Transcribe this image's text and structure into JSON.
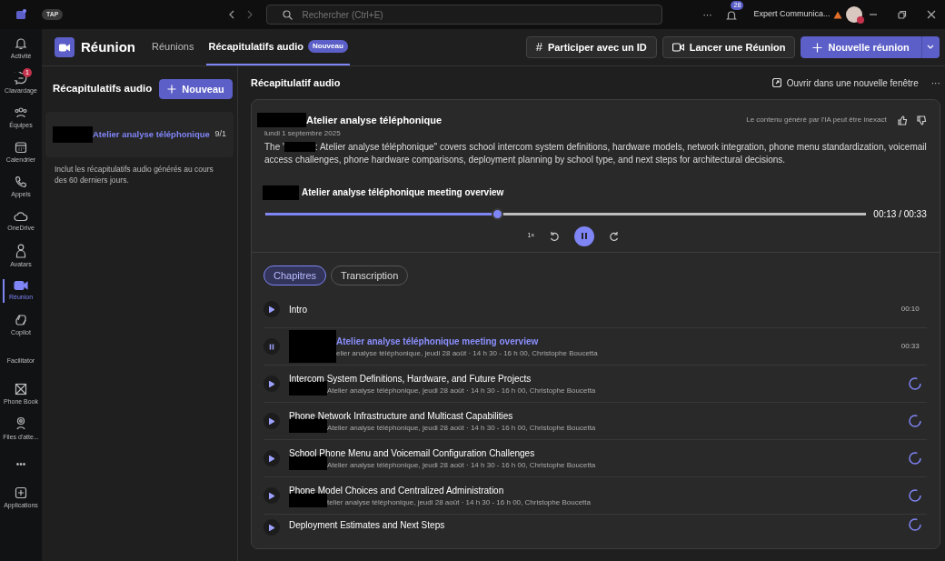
{
  "titlebar": {
    "org_badge": "TAP",
    "search": {
      "placeholder": "Rechercher (Ctrl+E)"
    },
    "more": "···",
    "notifications": "28",
    "user": "Expert Communica..."
  },
  "rail": [
    {
      "label": "Activité",
      "kind": "icon",
      "selected": false
    },
    {
      "label": "Clavardage",
      "kind": "icon",
      "badge": "1",
      "selected": false
    },
    {
      "label": "Équipes",
      "kind": "icon",
      "selected": false
    },
    {
      "label": "Calendrier",
      "kind": "icon",
      "selected": false
    },
    {
      "label": "Appels",
      "kind": "icon",
      "selected": false
    },
    {
      "label": "OneDrive",
      "kind": "icon",
      "selected": false
    },
    {
      "label": "Avatars",
      "kind": "icon",
      "selected": false
    },
    {
      "label": "Réunion",
      "kind": "icon",
      "selected": true
    },
    {
      "label": "Copilot",
      "kind": "icon",
      "selected": false
    },
    {
      "label": "Facilitator",
      "kind": "label",
      "selected": false
    },
    {
      "label": "Phone Book",
      "kind": "icon",
      "selected": false
    },
    {
      "label": "Files d'atte...",
      "kind": "icon",
      "selected": false
    },
    {
      "label": "•••",
      "kind": "more",
      "selected": false
    },
    {
      "label": "Applications",
      "kind": "icon",
      "selected": false
    }
  ],
  "header": {
    "title": "Réunion",
    "tabs": [
      {
        "label": "Réunions",
        "selected": false
      },
      {
        "label": "Récapitulatifs audio",
        "badge": "Nouveau",
        "selected": true
      }
    ],
    "buttons": [
      {
        "label": "Participer avec un ID",
        "kind": "hash",
        "symbol": "#"
      },
      {
        "label": "Lancer une Réunion",
        "kind": "camera"
      },
      {
        "label": "Nouvelle réunion",
        "kind": "primary"
      }
    ]
  },
  "left_panel": {
    "title": "Récapitulatifs audio",
    "new_button": "Nouveau",
    "items": [
      {
        "title": "Atelier analyse téléphonique",
        "date": "9/1",
        "selected": true
      }
    ],
    "note": "Inclut les récapitulatifs audio générés au cours des 60 derniers jours."
  },
  "main": {
    "title": "Récapitulatif audio",
    "open_window": "Ouvrir dans une nouvelle fenêtre",
    "more": "···",
    "recap": {
      "title": "Atelier analyse téléphonique",
      "ai_notice": "Le contenu généré par l'IA peut être inexact",
      "date": "lundi 1 septembre 2025",
      "description_start": "The '",
      "description_line_1": ": Atelier analyse téléphonique\" covers school intercom system definitions, hardware models, network integration, phone menu standardization, voicemail",
      "description_line_2": "access challenges, phone hardware comparisons, deployment planning by school type, and next steps for architectural decisions."
    },
    "player": {
      "title": "Atelier analyse téléphonique meeting overview",
      "level": 0.385,
      "time": "00:13 / 00:33",
      "speed": "1×",
      "playing": true
    },
    "tabs": [
      {
        "label": "Chapitres",
        "selected": true
      },
      {
        "label": "Transcription",
        "selected": false
      }
    ],
    "chapters": [
      {
        "title": "Intro",
        "time": "00:10",
        "playing": false,
        "loading": false,
        "redacted": false
      },
      {
        "title": "Atelier analyse téléphonique meeting overview",
        "subtitle": "elier analyse téléphonique, jeudi 28 août · 14 h 30 - 16 h 00, Christophe Boucetta",
        "time": "00:33",
        "playing": true,
        "loading": false,
        "redacted": true
      },
      {
        "title": "Intercom System Definitions, Hardware, and Future Projects",
        "subtitle": "Atelier analyse téléphonique, jeudi 28 août · 14 h 30 - 16 h 00, Christophe Boucetta",
        "playing": false,
        "loading": true,
        "redacted": true
      },
      {
        "title": "Phone Network Infrastructure and Multicast Capabilities",
        "subtitle": "Atelier analyse téléphonique, jeudi 28 août · 14 h 30 - 16 h 00, Christophe Boucetta",
        "playing": false,
        "loading": true,
        "redacted": true
      },
      {
        "title": "School Phone Menu and Voicemail Configuration Challenges",
        "subtitle": "Atelier analyse téléphonique, jeudi 28 août · 14 h 30 - 16 h 00, Christophe Boucetta",
        "playing": false,
        "loading": true,
        "redacted": true
      },
      {
        "title": "Phone Model Choices and Centralized Administration",
        "subtitle": "telier analyse téléphonique, jeudi 28 août · 14 h 30 - 16 h 00, Christophe Boucetta",
        "playing": false,
        "loading": true,
        "redacted": true
      },
      {
        "title": "Deployment Estimates and Next Steps",
        "playing": false,
        "loading": true,
        "redacted": false
      }
    ]
  }
}
